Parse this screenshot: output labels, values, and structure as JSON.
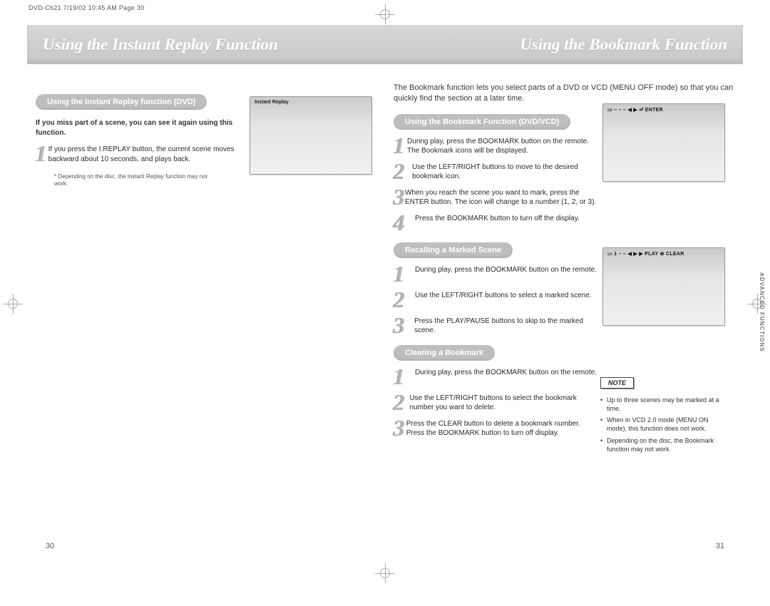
{
  "meta": {
    "headerline": "DVD-C621  7/19/02 10:45 AM  Page 30"
  },
  "titlebar": {
    "left": "Using the Instant Replay Function",
    "right": "Using the Bookmark Function"
  },
  "left": {
    "pill": "Using the Instant Replay function (DVD)",
    "lead": "If you miss part of a scene, you can see it again using this function.",
    "steps": [
      "If you press the I.REPLAY button, the current scene moves backward about 10 seconds, and plays back."
    ],
    "footnote": "Depending on the disc, the Instant Replay function may not work.",
    "screen_label": "Instant Replay"
  },
  "right": {
    "intro": "The Bookmark function lets you select parts of a DVD or VCD (MENU OFF mode) so that you can quickly find the section at a later time.",
    "sections": [
      {
        "pill": "Using the Bookmark Function (DVD/VCD)",
        "steps": [
          "During play, press the BOOKMARK button on the remote. The Bookmark icons will be displayed.",
          "Use the LEFT/RIGHT buttons to move to the desired bookmark icon.",
          "When you reach the scene you want to mark, press the ENTER button. The icon will change to a number (1, 2, or 3).",
          "Press the BOOKMARK button to turn off the display."
        ]
      },
      {
        "pill": "Recalling a Marked Scene",
        "steps": [
          "During play, press the BOOKMARK button on the remote.",
          "Use the LEFT/RIGHT buttons to select a marked scene.",
          "Press the PLAY/PAUSE buttons to skip to the marked scene."
        ]
      },
      {
        "pill": "Clearing a Bookmark",
        "steps": [
          "During play, press the BOOKMARK button on the remote.",
          "Use the LEFT/RIGHT buttons to select the bookmark number you want to delete.",
          "Press the CLEAR button to delete a bookmark number. Press the BOOKMARK button to turn off display."
        ]
      }
    ],
    "osd1": "▭ –  –  –  ◀ ▶ ⏎ ENTER",
    "osd2": "▭ 1  –  –  ◀ ▶ ▶ PLAY ⊗ CLEAR",
    "note_title": "NOTE",
    "notes": [
      "Up to three scenes may be marked at a time.",
      "When in VCD 2.0 mode (MENU ON mode), this function does not work.",
      "Depending on the disc, the Bookmark function may not work."
    ],
    "sidelabel": "ADVANCED FUNCTIONS"
  },
  "pagenum": {
    "left": "30",
    "right": "31"
  }
}
